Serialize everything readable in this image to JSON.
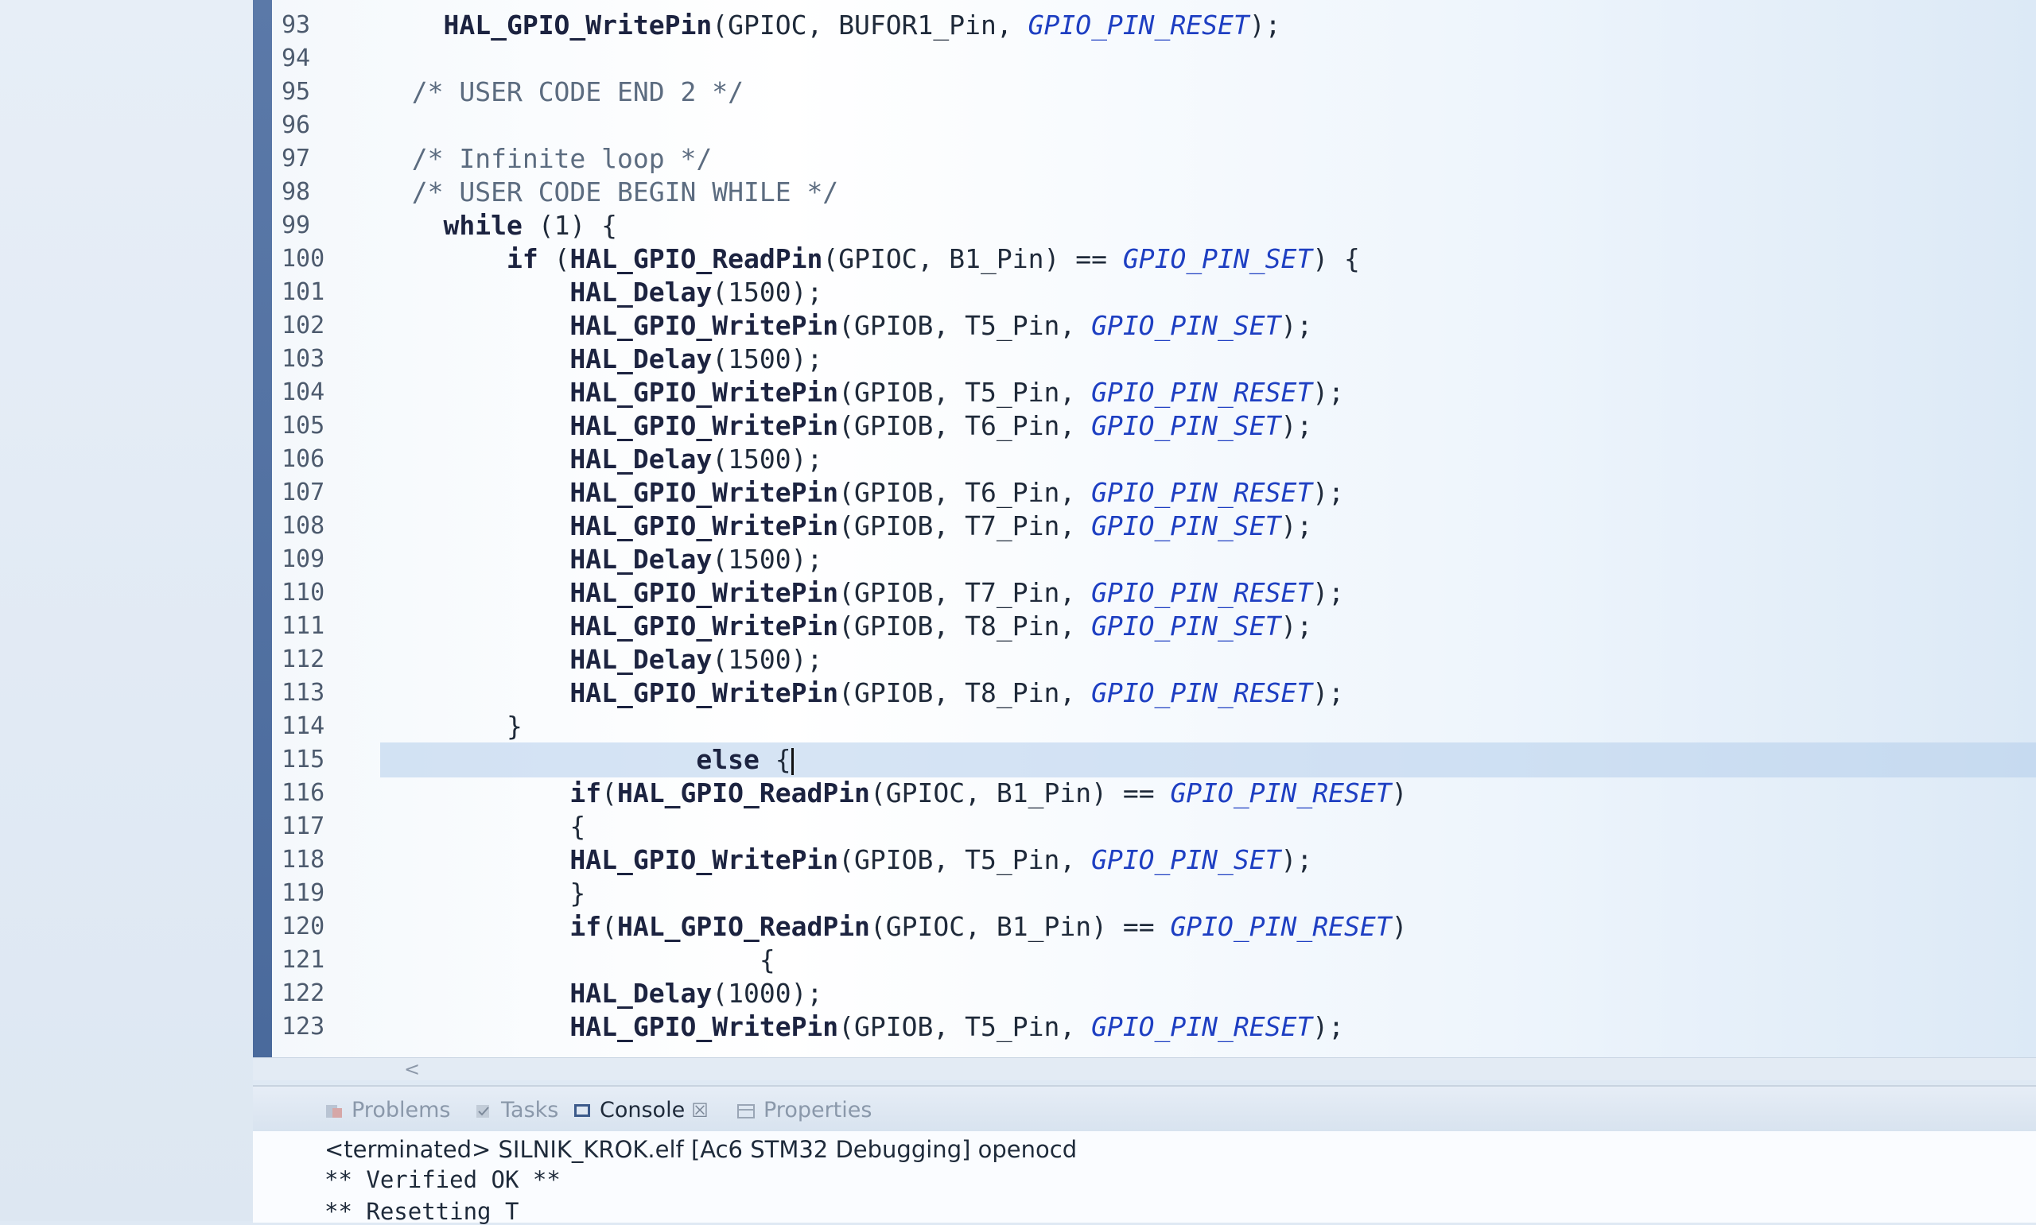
{
  "editor": {
    "lines": [
      {
        "num": "93",
        "parts": [
          {
            "t": "    "
          },
          {
            "t": "HAL_GPIO_WritePin",
            "c": "fn"
          },
          {
            "t": "(GPIOC, BUFOR1_Pin, "
          },
          {
            "t": "GPIO_PIN_RESET",
            "c": "ct"
          },
          {
            "t": ");"
          }
        ]
      },
      {
        "num": "94",
        "parts": []
      },
      {
        "num": "95",
        "parts": [
          {
            "t": "  "
          },
          {
            "t": "/* USER CODE END 2 */",
            "c": "cm"
          }
        ]
      },
      {
        "num": "96",
        "parts": []
      },
      {
        "num": "97",
        "parts": [
          {
            "t": "  "
          },
          {
            "t": "/* Infinite loop */",
            "c": "cm"
          }
        ]
      },
      {
        "num": "98",
        "parts": [
          {
            "t": "  "
          },
          {
            "t": "/* USER CODE BEGIN WHILE */",
            "c": "cm"
          }
        ]
      },
      {
        "num": "99",
        "parts": [
          {
            "t": "    "
          },
          {
            "t": "while",
            "c": "kw"
          },
          {
            "t": " (1) {"
          }
        ]
      },
      {
        "num": "100",
        "parts": [
          {
            "t": "        "
          },
          {
            "t": "if",
            "c": "kw"
          },
          {
            "t": " ("
          },
          {
            "t": "HAL_GPIO_ReadPin",
            "c": "fn"
          },
          {
            "t": "(GPIOC, B1_Pin) == "
          },
          {
            "t": "GPIO_PIN_SET",
            "c": "ct"
          },
          {
            "t": ") {"
          }
        ]
      },
      {
        "num": "101",
        "parts": [
          {
            "t": "            "
          },
          {
            "t": "HAL_Delay",
            "c": "fn"
          },
          {
            "t": "(1500);"
          }
        ]
      },
      {
        "num": "102",
        "parts": [
          {
            "t": "            "
          },
          {
            "t": "HAL_GPIO_WritePin",
            "c": "fn"
          },
          {
            "t": "(GPIOB, T5_Pin, "
          },
          {
            "t": "GPIO_PIN_SET",
            "c": "ct"
          },
          {
            "t": ");"
          }
        ]
      },
      {
        "num": "103",
        "parts": [
          {
            "t": "            "
          },
          {
            "t": "HAL_Delay",
            "c": "fn"
          },
          {
            "t": "(1500);"
          }
        ]
      },
      {
        "num": "104",
        "parts": [
          {
            "t": "            "
          },
          {
            "t": "HAL_GPIO_WritePin",
            "c": "fn"
          },
          {
            "t": "(GPIOB, T5_Pin, "
          },
          {
            "t": "GPIO_PIN_RESET",
            "c": "ct"
          },
          {
            "t": ");"
          }
        ]
      },
      {
        "num": "105",
        "parts": [
          {
            "t": "            "
          },
          {
            "t": "HAL_GPIO_WritePin",
            "c": "fn"
          },
          {
            "t": "(GPIOB, T6_Pin, "
          },
          {
            "t": "GPIO_PIN_SET",
            "c": "ct"
          },
          {
            "t": ");"
          }
        ]
      },
      {
        "num": "106",
        "parts": [
          {
            "t": "            "
          },
          {
            "t": "HAL_Delay",
            "c": "fn"
          },
          {
            "t": "(1500);"
          }
        ]
      },
      {
        "num": "107",
        "parts": [
          {
            "t": "            "
          },
          {
            "t": "HAL_GPIO_WritePin",
            "c": "fn"
          },
          {
            "t": "(GPIOB, T6_Pin, "
          },
          {
            "t": "GPIO_PIN_RESET",
            "c": "ct"
          },
          {
            "t": ");"
          }
        ]
      },
      {
        "num": "108",
        "parts": [
          {
            "t": "            "
          },
          {
            "t": "HAL_GPIO_WritePin",
            "c": "fn"
          },
          {
            "t": "(GPIOB, T7_Pin, "
          },
          {
            "t": "GPIO_PIN_SET",
            "c": "ct"
          },
          {
            "t": ");"
          }
        ]
      },
      {
        "num": "109",
        "parts": [
          {
            "t": "            "
          },
          {
            "t": "HAL_Delay",
            "c": "fn"
          },
          {
            "t": "(1500);"
          }
        ]
      },
      {
        "num": "110",
        "parts": [
          {
            "t": "            "
          },
          {
            "t": "HAL_GPIO_WritePin",
            "c": "fn"
          },
          {
            "t": "(GPIOB, T7_Pin, "
          },
          {
            "t": "GPIO_PIN_RESET",
            "c": "ct"
          },
          {
            "t": ");"
          }
        ]
      },
      {
        "num": "111",
        "parts": [
          {
            "t": "            "
          },
          {
            "t": "HAL_GPIO_WritePin",
            "c": "fn"
          },
          {
            "t": "(GPIOB, T8_Pin, "
          },
          {
            "t": "GPIO_PIN_SET",
            "c": "ct"
          },
          {
            "t": ");"
          }
        ]
      },
      {
        "num": "112",
        "parts": [
          {
            "t": "            "
          },
          {
            "t": "HAL_Delay",
            "c": "fn"
          },
          {
            "t": "(1500);"
          }
        ]
      },
      {
        "num": "113",
        "parts": [
          {
            "t": "            "
          },
          {
            "t": "HAL_GPIO_WritePin",
            "c": "fn"
          },
          {
            "t": "(GPIOB, T8_Pin, "
          },
          {
            "t": "GPIO_PIN_RESET",
            "c": "ct"
          },
          {
            "t": ");"
          }
        ]
      },
      {
        "num": "114",
        "parts": [
          {
            "t": "        }"
          }
        ]
      },
      {
        "num": "115",
        "current": true,
        "caret": true,
        "parts": [
          {
            "t": "                    "
          },
          {
            "t": "else",
            "c": "kw"
          },
          {
            "t": " {"
          }
        ]
      },
      {
        "num": "116",
        "parts": [
          {
            "t": "            "
          },
          {
            "t": "if",
            "c": "kw"
          },
          {
            "t": "("
          },
          {
            "t": "HAL_GPIO_ReadPin",
            "c": "fn"
          },
          {
            "t": "(GPIOC, B1_Pin) == "
          },
          {
            "t": "GPIO_PIN_RESET",
            "c": "ct"
          },
          {
            "t": ")"
          }
        ]
      },
      {
        "num": "117",
        "parts": [
          {
            "t": "            {"
          }
        ]
      },
      {
        "num": "118",
        "parts": [
          {
            "t": "            "
          },
          {
            "t": "HAL_GPIO_WritePin",
            "c": "fn"
          },
          {
            "t": "(GPIOB, T5_Pin, "
          },
          {
            "t": "GPIO_PIN_SET",
            "c": "ct"
          },
          {
            "t": ");"
          }
        ]
      },
      {
        "num": "119",
        "parts": [
          {
            "t": "            }"
          }
        ]
      },
      {
        "num": "120",
        "parts": [
          {
            "t": "            "
          },
          {
            "t": "if",
            "c": "kw"
          },
          {
            "t": "("
          },
          {
            "t": "HAL_GPIO_ReadPin",
            "c": "fn"
          },
          {
            "t": "(GPIOC, B1_Pin) == "
          },
          {
            "t": "GPIO_PIN_RESET",
            "c": "ct"
          },
          {
            "t": ")"
          }
        ]
      },
      {
        "num": "121",
        "parts": [
          {
            "t": "                        {"
          }
        ]
      },
      {
        "num": "122",
        "parts": [
          {
            "t": "            "
          },
          {
            "t": "HAL_Delay",
            "c": "fn"
          },
          {
            "t": "(1000);"
          }
        ]
      },
      {
        "num": "123",
        "parts": [
          {
            "t": "            "
          },
          {
            "t": "HAL_GPIO_WritePin",
            "c": "fn"
          },
          {
            "t": "(GPIOB, T5_Pin, "
          },
          {
            "t": "GPIO_PIN_RESET",
            "c": "ct"
          },
          {
            "t": ");"
          }
        ]
      }
    ]
  },
  "scroll": {
    "left_arrow": "<"
  },
  "panel": {
    "tabs": {
      "problems": "Problems",
      "tasks": "Tasks",
      "console": "Console",
      "console_close": "☒",
      "properties": "Properties"
    },
    "console": {
      "status": "<terminated> SILNIK_KROK.elf [Ac6 STM32 Debugging] openocd",
      "line1": "** Verified OK **",
      "line2": "** Resetting T"
    }
  },
  "colors": {
    "keyword": "#1c2340",
    "constant": "#1e3fc2",
    "comment": "#5c6c80",
    "gutter": "#4a6a9c"
  }
}
